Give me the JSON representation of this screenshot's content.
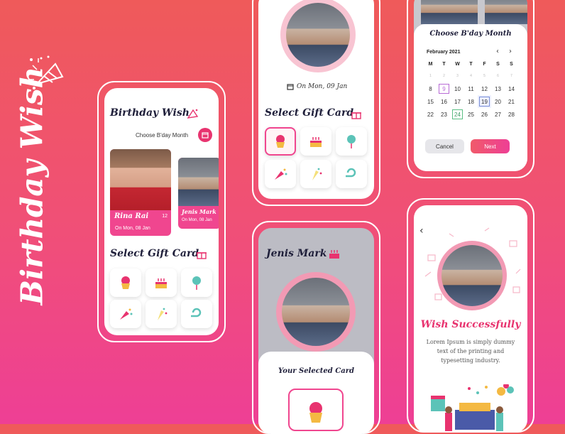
{
  "brand": {
    "title": "Birthday Wish"
  },
  "screen1": {
    "title": "Birthday Wish",
    "month_label": "Choose B'day Month",
    "person1": {
      "name": "Rina Rai",
      "age": "12",
      "date": "On Mon, 08 Jan"
    },
    "person2": {
      "name": "Jenis Mark",
      "date": "On Mon, 08 Jan"
    },
    "gift_title": "Select Gift Card"
  },
  "screen2": {
    "date": "On Mon, 09 Jan",
    "gift_title": "Select Gift Card"
  },
  "screen3": {
    "title": "Jenis Mark",
    "selected_title": "Your Selected Card"
  },
  "screen4": {
    "title": "Choose B'day Month",
    "month": "February 2021",
    "weekdays": [
      "M",
      "T",
      "W",
      "T",
      "F",
      "S",
      "S"
    ],
    "weeks": [
      [
        "1",
        "2",
        "3",
        "4",
        "5",
        "6",
        "7"
      ],
      [
        "8",
        "9",
        "10",
        "11",
        "12",
        "13",
        "14"
      ],
      [
        "15",
        "16",
        "17",
        "18",
        "19",
        "20",
        "21"
      ],
      [
        "22",
        "23",
        "24",
        "25",
        "26",
        "27",
        "28"
      ]
    ],
    "cancel": "Cancel",
    "next": "Next"
  },
  "screen5": {
    "title": "Wish Successfully",
    "body": "Lorem Ipsum is simply dummy text of the printing and typesetting industry."
  },
  "gifts": [
    "cupcake-icon",
    "cake-icon",
    "lollipop-icon",
    "party-popper-icon",
    "confetti-icon",
    "party-blower-icon"
  ],
  "colors": {
    "accent": "#f0468f",
    "accent_dark": "#e8336f",
    "bg_top": "#ef5a5a",
    "bg_bottom": "#ee3f95"
  }
}
